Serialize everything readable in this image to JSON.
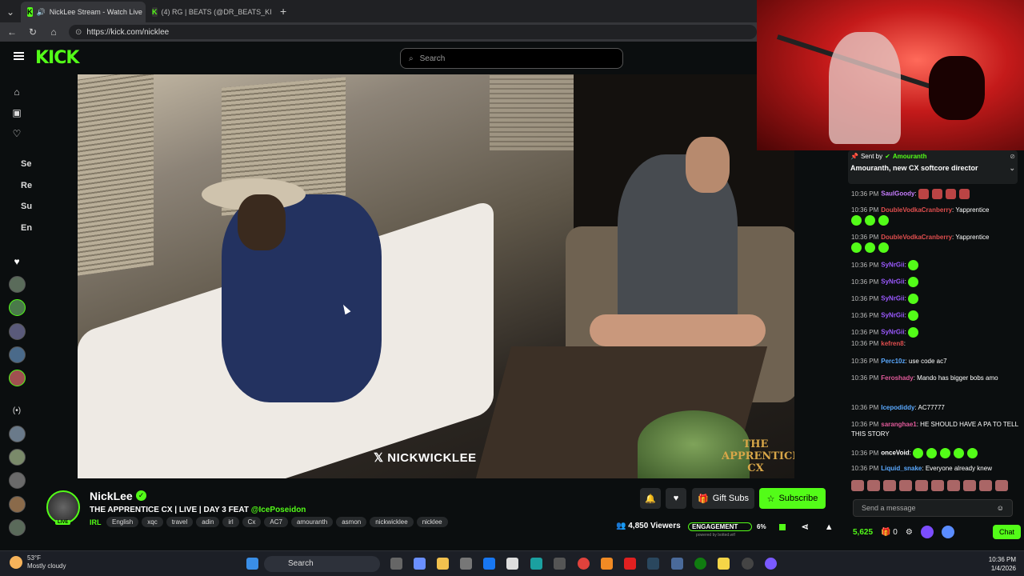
{
  "browser": {
    "tabs": [
      {
        "label": "NickLee Stream - Watch Live",
        "active": true
      },
      {
        "label": "(4) RG | BEATS (@DR_BEATS_KICK)",
        "active": false
      }
    ],
    "new_tab": "+",
    "url": "https://kick.com/nicklee"
  },
  "kick": {
    "logo": "KICK",
    "search_placeholder": "Search",
    "sidebar_labels": [
      "Se",
      "Re",
      "Su",
      "En"
    ],
    "video_watermark": "NICKWICKLEE",
    "video_logo": "THE APPRENTICE CX"
  },
  "streamer": {
    "name": "NickLee",
    "live_badge": "LIVE",
    "title_prefix": "THE APPRENTICE CX  |  LIVE  |  DAY 3 FEAT ",
    "title_mention": "@IcePoseidon",
    "category": "IRL",
    "tags": [
      "English",
      "xqc",
      "travel",
      "adin",
      "irl",
      "Cx",
      "AC7",
      "amouranth",
      "asmon",
      "nickwicklee",
      "nicklee"
    ],
    "gift_subs_label": "Gift Subs",
    "subscribe_label": "Subscribe",
    "viewers": "4,850 Viewers",
    "engagement_label": "ENGAGEMENT",
    "engagement_value": "6%",
    "powered_by": "powered by botted.wtf"
  },
  "chat": {
    "pinned_sent_by": "Sent by",
    "pinned_user": "Amouranth",
    "pinned_text": "Amouranth, new CX softcore director",
    "messages": [
      {
        "time": "10:36 PM",
        "user": "SaulGoody",
        "text": "",
        "color": "#c77dff"
      },
      {
        "time": "10:36 PM",
        "user": "DoubleVodkaCranberry",
        "text": "Yapprentice",
        "color": "#e04e4e"
      },
      {
        "time": "10:36 PM",
        "user": "DoubleVodkaCranberry",
        "text": "Yapprentice",
        "color": "#e04e4e"
      },
      {
        "time": "10:36 PM",
        "user": "SyNrGii",
        "text": "",
        "color": "#9b59ff"
      },
      {
        "time": "10:36 PM",
        "user": "SyNrGii",
        "text": "",
        "color": "#9b59ff"
      },
      {
        "time": "10:36 PM",
        "user": "SyNrGii",
        "text": "",
        "color": "#9b59ff"
      },
      {
        "time": "10:36 PM",
        "user": "SyNrGii",
        "text": "",
        "color": "#9b59ff"
      },
      {
        "time": "10:36 PM",
        "user": "SyNrGii",
        "text": "",
        "color": "#9b59ff"
      },
      {
        "time": "10:36 PM",
        "user": "kefren8",
        "text": "",
        "color": "#e04e4e"
      },
      {
        "time": "10:36 PM",
        "user": "Perc10z",
        "text": "use code ac7",
        "color": "#5aa9ff"
      },
      {
        "time": "10:36 PM",
        "user": "Feroshady",
        "text": "Mando has bigger bobs amo",
        "color": "#e05a9a"
      },
      {
        "time": "10:36 PM",
        "user": "Icepodiddy",
        "text": "AC77777",
        "color": "#5aa9ff"
      },
      {
        "time": "10:36 PM",
        "user": "saranghae1",
        "text": "HE SHOULD HAVE A PA TO TELL THIS STORY",
        "color": "#e05a9a"
      },
      {
        "time": "10:36 PM",
        "user": "onceVoid",
        "text": "",
        "color": "#ffffff"
      },
      {
        "time": "10:36 PM",
        "user": "Liquid_snake",
        "text": "Everyone already knew",
        "color": "#5aa9ff"
      }
    ],
    "input_placeholder": "Send a message",
    "points": "5,625",
    "count": "0",
    "chat_button": "Chat"
  },
  "taskbar": {
    "weather_temp": "53°F",
    "weather_desc": "Mostly cloudy",
    "search_label": "Search",
    "time": "10:36 PM",
    "date": "1/4/2026"
  },
  "colors": {
    "kick_green": "#53fc18",
    "background": "#0b0e0f"
  }
}
